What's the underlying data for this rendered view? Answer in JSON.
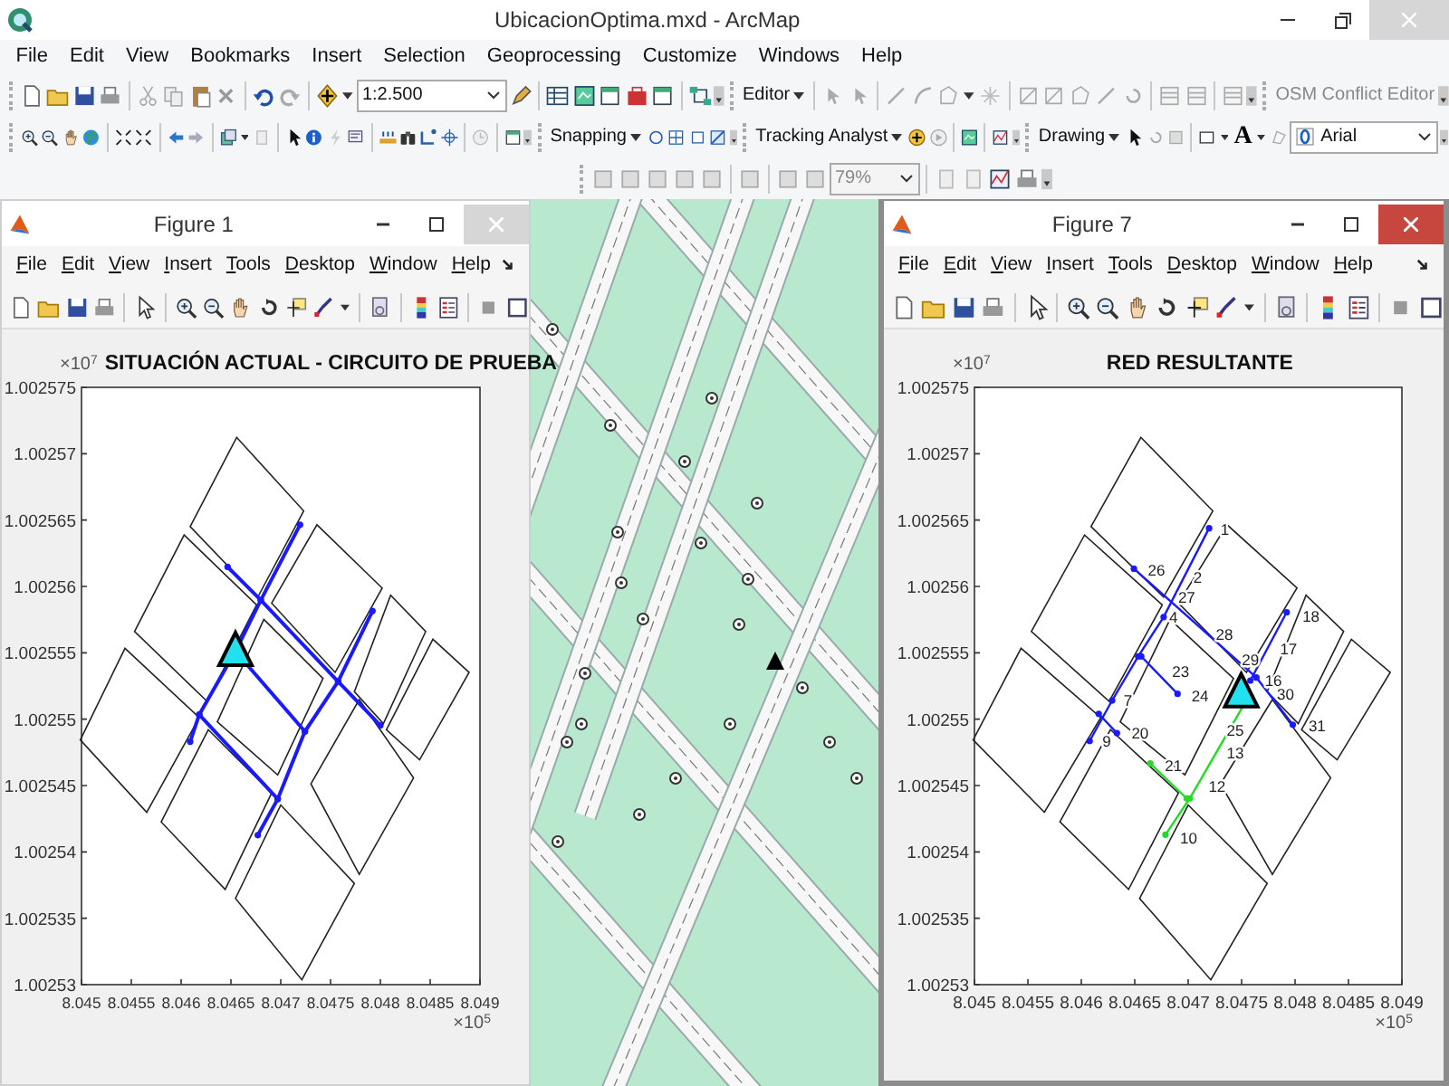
{
  "window": {
    "title": "UbicacionOptima.mxd - ArcMap"
  },
  "menu": [
    "File",
    "Edit",
    "View",
    "Bookmarks",
    "Insert",
    "Selection",
    "Geoprocessing",
    "Customize",
    "Windows",
    "Help"
  ],
  "toolbars": {
    "scale": "1:2.500",
    "editor": "Editor",
    "osm": "OSM Conflict Editor",
    "snapping": "Snapping",
    "tracking": "Tracking Analyst",
    "drawing": "Drawing",
    "text_tool": "A",
    "font": "Arial",
    "zoom": "79%"
  },
  "figures": [
    {
      "title": "Figure 1",
      "active": false,
      "menu": [
        "File",
        "Edit",
        "View",
        "Insert",
        "Tools",
        "Desktop",
        "Window",
        "Help"
      ],
      "plot": {
        "kind": "current",
        "title": "SITUACIÓN ACTUAL - CIRCUITO DE PRUEBA",
        "y_exponent": "×10$^{7}$",
        "x_exponent": "×10$^{5}$",
        "yticks": [
          "1.002575",
          "1.00257",
          "1.002565",
          "1.00256",
          "1.002555",
          "1.00255",
          "1.002545",
          "1.00254",
          "1.002535",
          "1.00253"
        ],
        "xticks": [
          "8.045",
          "8.0455",
          "8.046",
          "8.0465",
          "8.047",
          "8.0475",
          "8.048",
          "8.0485",
          "8.049"
        ]
      }
    },
    {
      "title": "Figure 7",
      "active": true,
      "menu": [
        "File",
        "Edit",
        "View",
        "Insert",
        "Tools",
        "Desktop",
        "Window",
        "Help"
      ],
      "plot": {
        "kind": "result",
        "title": "RED RESULTANTE",
        "y_exponent": "×10$^{7}$",
        "x_exponent": "×10$^{5}$",
        "yticks": [
          "1.002575",
          "1.00257",
          "1.002565",
          "1.00256",
          "1.002555",
          "1.00255",
          "1.002545",
          "1.00254",
          "1.002535",
          "1.00253"
        ],
        "xticks": [
          "8.045",
          "8.0455",
          "8.046",
          "8.0465",
          "8.047",
          "8.0475",
          "8.048",
          "8.0485",
          "8.049"
        ],
        "node_labels": [
          "1",
          "2",
          "26",
          "27",
          "4",
          "28",
          "29",
          "18",
          "17",
          "23",
          "24",
          "16",
          "30",
          "7",
          "31",
          "9",
          "20",
          "25",
          "13",
          "21",
          "12",
          "10"
        ]
      }
    }
  ]
}
